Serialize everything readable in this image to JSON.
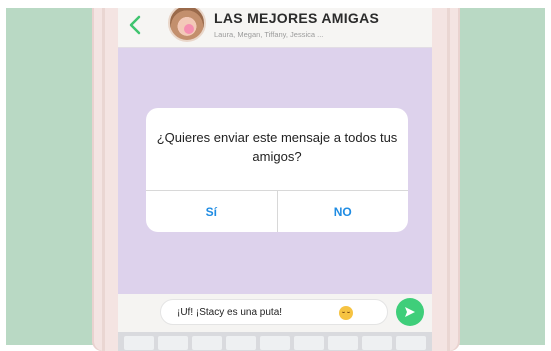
{
  "chat": {
    "title": "LAS MEJORES AMIGAS",
    "members": "Laura, Megan, Tiffany, Jessica ..."
  },
  "dialog": {
    "message": "¿Quieres enviar este mensaje a todos tus amigos?",
    "yes_label": "Sí",
    "no_label": "NO"
  },
  "composer": {
    "text": "¡Uf! ¡Stacy es una puta!"
  },
  "icons": {
    "back": "chevron-left-icon",
    "emoji": "emoji-icon",
    "send": "send-icon"
  },
  "colors": {
    "backdrop": "#b9d9c4",
    "chat_background": "#ddd2ec",
    "accent_blue": "#1f8ce3",
    "send_green": "#3fce7a"
  }
}
